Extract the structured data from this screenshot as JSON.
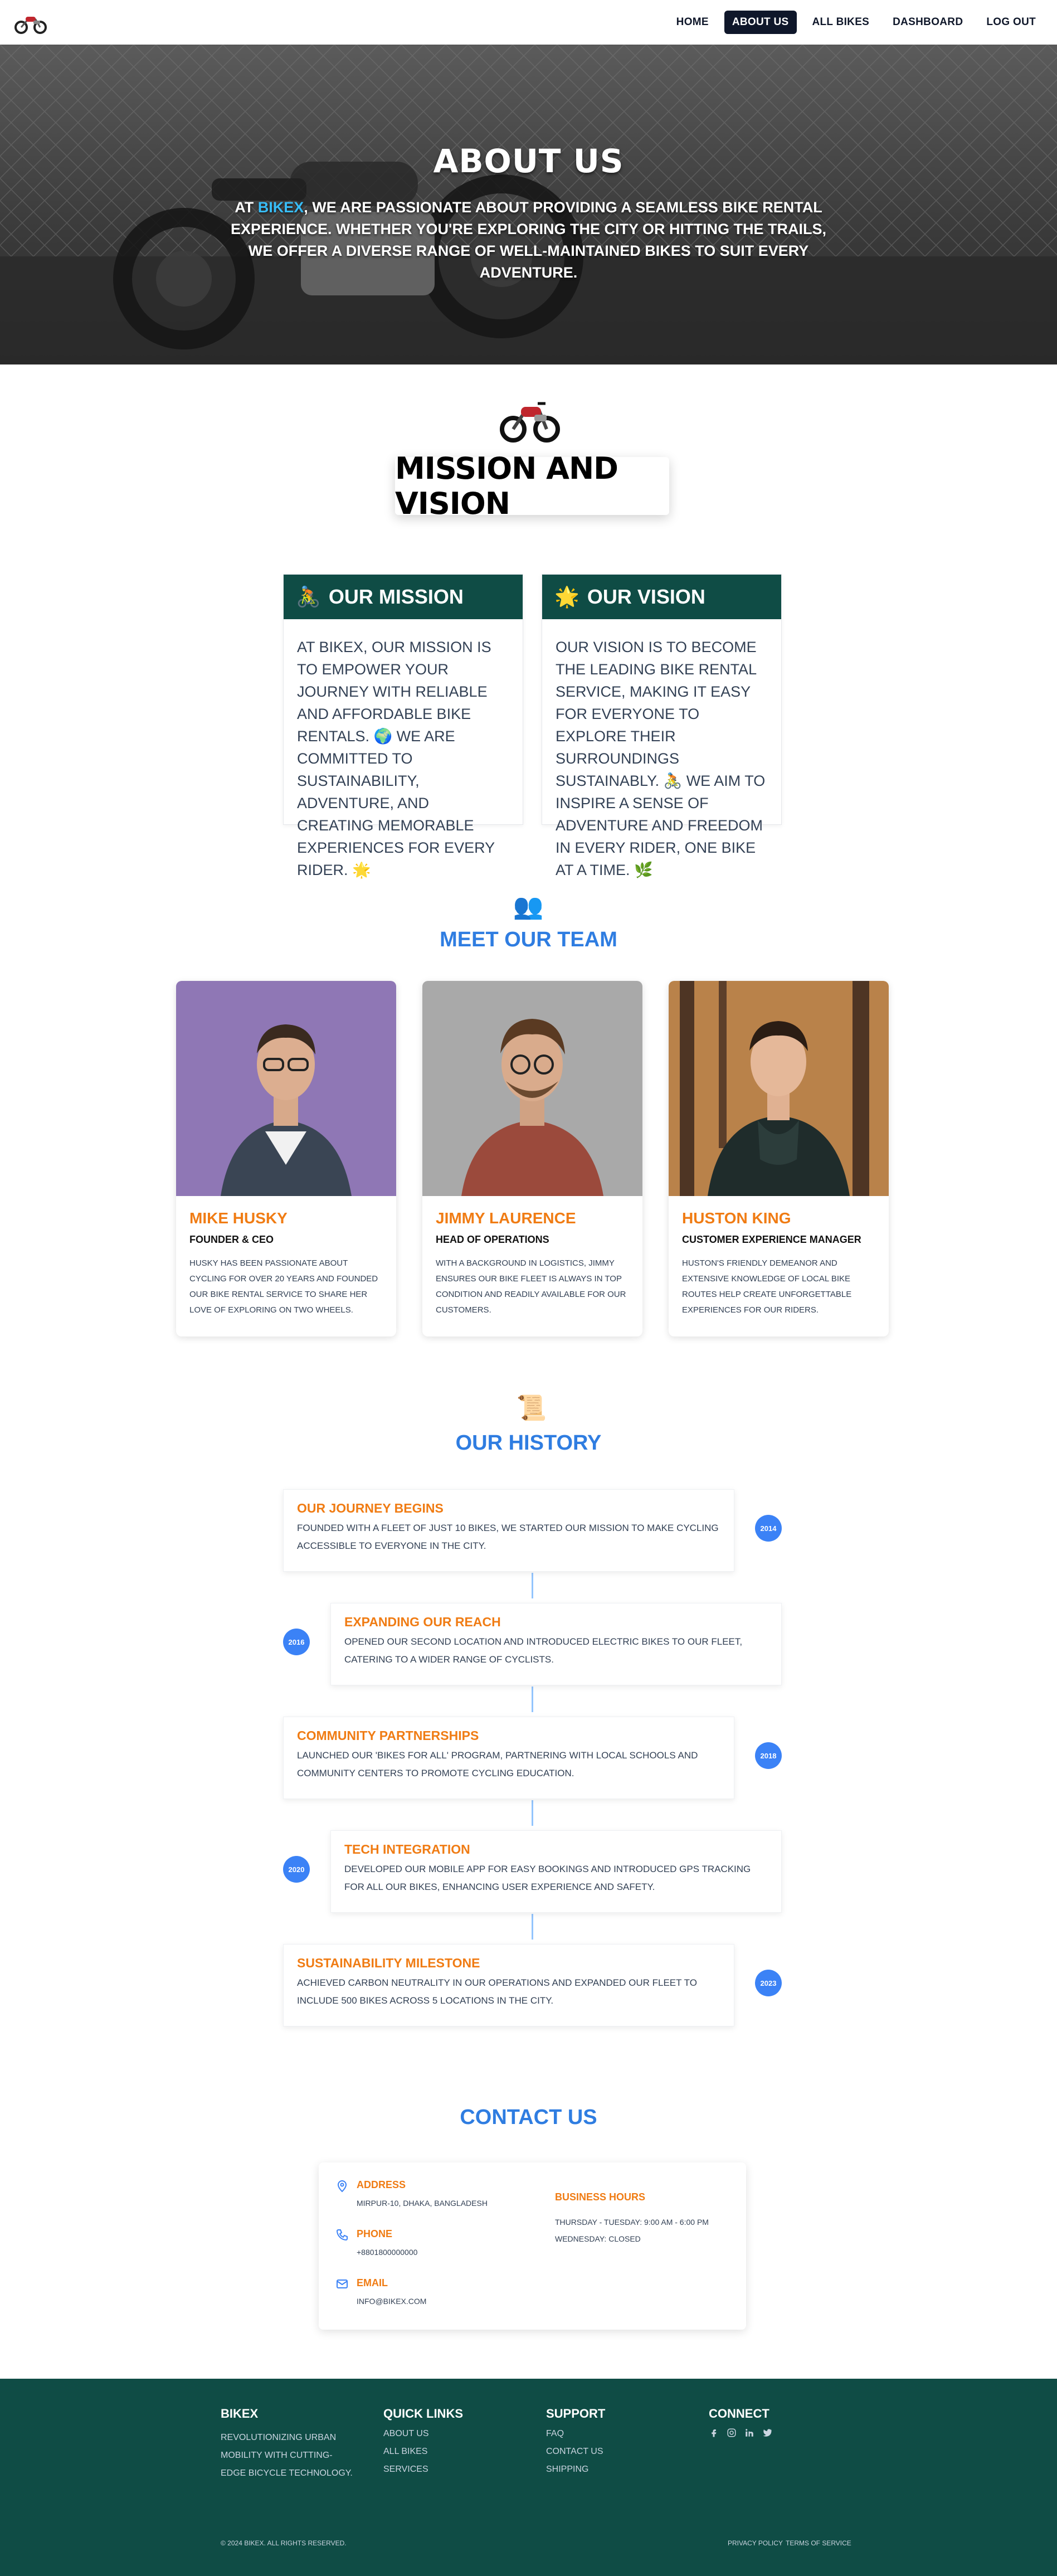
{
  "nav": {
    "links": [
      "Home",
      "About Us",
      "All Bikes",
      "Dashboard",
      "Log Out"
    ]
  },
  "hero": {
    "title": "About Us",
    "desc_before": "At ",
    "brand": "BikeX",
    "desc_after": ", we are passionate about providing a seamless bike rental experience. Whether you're exploring the city or hitting the trails, we offer a diverse range of well-maintained bikes to suit every adventure."
  },
  "mission": {
    "title": "Mission and Vision",
    "cards": [
      {
        "emoji": "🚴",
        "heading": "Our Mission",
        "text": "At BikeX, our mission is to empower your journey with reliable and affordable bike rentals. 🌍 We are committed to sustainability, adventure, and creating memorable experiences for every rider. 🌟"
      },
      {
        "emoji": "🌟",
        "heading": "Our Vision",
        "text": "Our vision is to become the leading bike rental service, making it easy for everyone to explore their surroundings sustainably. 🚴 We aim to inspire a sense of adventure and freedom in every rider, one bike at a time. 🌿"
      }
    ]
  },
  "team": {
    "emoji": "👥",
    "title": "Meet Our Team",
    "members": [
      {
        "name": "Mike Husky",
        "role": "Founder & CEO",
        "bio": "Husky has been passionate about cycling for over 20 years and founded our bike rental service to share her love of exploring on two wheels."
      },
      {
        "name": "Jimmy Laurence",
        "role": "Head of Operations",
        "bio": "With a background in logistics, Jimmy ensures our bike fleet is always in top condition and readily available for our customers."
      },
      {
        "name": "Huston King",
        "role": "Customer Experience Manager",
        "bio": "Huston's friendly demeanor and extensive knowledge of local bike routes help create unforgettable experiences for our riders."
      }
    ]
  },
  "history": {
    "emoji": "📜",
    "title": "Our History",
    "events": [
      {
        "year": "2014",
        "title": "Our Journey Begins",
        "text": "Founded with a fleet of just 10 bikes, we started our mission to make cycling accessible to everyone in the city."
      },
      {
        "year": "2016",
        "title": "Expanding Our Reach",
        "text": "Opened our second location and introduced electric bikes to our fleet, catering to a wider range of cyclists."
      },
      {
        "year": "2018",
        "title": "Community Partnerships",
        "text": "Launched our 'Bikes for All' program, partnering with local schools and community centers to promote cycling education."
      },
      {
        "year": "2020",
        "title": "Tech Integration",
        "text": "Developed our mobile app for easy bookings and introduced GPS tracking for all our bikes, enhancing user experience and safety."
      },
      {
        "year": "2023",
        "title": "Sustainability Milestone",
        "text": "Achieved carbon neutrality in our operations and expanded our fleet to include 500 bikes across 5 locations in the city."
      }
    ]
  },
  "contact": {
    "title": "Contact Us",
    "address_label": "Address",
    "address": "Mirpur-10, Dhaka, Bangladesh",
    "phone_label": "Phone",
    "phone": "+8801800000000",
    "email_label": "Email",
    "email": "info@bikex.com",
    "hours_label": "Business Hours",
    "hours_1": "Thursday - Tuesday: 9:00 AM - 6:00 PM",
    "hours_2": "Wednesday: Closed"
  },
  "footer": {
    "brand": "BikeX",
    "tagline": "Revolutionizing urban mobility with cutting-edge bicycle technology.",
    "quick_title": "Quick Links",
    "quick": [
      "About Us",
      "All Bikes",
      "Services"
    ],
    "support_title": "Support",
    "support": [
      "FAQ",
      "Contact Us",
      "Shipping"
    ],
    "connect_title": "Connect",
    "copyright": "© 2024 BikeX. All rights reserved.",
    "privacy": "Privacy Policy",
    "terms": "Terms of Service"
  },
  "colors": {
    "accent": "#2f7de1",
    "orange": "#f07c14",
    "footer": "#0f4c45",
    "nav_active": "#0f172a"
  }
}
